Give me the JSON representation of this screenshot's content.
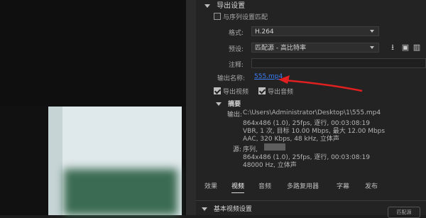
{
  "left": {},
  "export": {
    "section_title": "导出设置",
    "match_sequence_label": "与序列设置匹配",
    "format_label": "格式:",
    "format_value": "H.264",
    "preset_label": "预设:",
    "preset_value": "匹配源 - 高比特率",
    "comment_label": "注释:",
    "output_name_label": "输出名称:",
    "output_name_value": "555.mp4",
    "export_video_label": "导出视频",
    "export_audio_label": "导出音频"
  },
  "summary": {
    "title": "摘要",
    "output_label": "输出:",
    "output_lines": [
      "C:\\Users\\Administrator\\Desktop\\1\\555.mp4",
      "864x486 (1.0), 25fps, 逐行, 00:03:08:19",
      "VBR, 1 次, 目标 10.00 Mbps, 最大 12.00 Mbps",
      "AAC, 320 Kbps, 48 kHz, 立体声"
    ],
    "source_label": "源:",
    "source_lines": [
      "序列,",
      "864x486 (1.0), 25fps, 逐行, 00:03:08:19",
      "48000 Hz, 立体声"
    ]
  },
  "tabs": [
    "效果",
    "视频",
    "音频",
    "多路复用器",
    "字幕",
    "发布"
  ],
  "active_tab": "视频",
  "bottom": {
    "title": "基本视频设置",
    "button_label": "匹配源"
  },
  "colors": {
    "link": "#3b7ef5",
    "arrow": "#e02020"
  }
}
